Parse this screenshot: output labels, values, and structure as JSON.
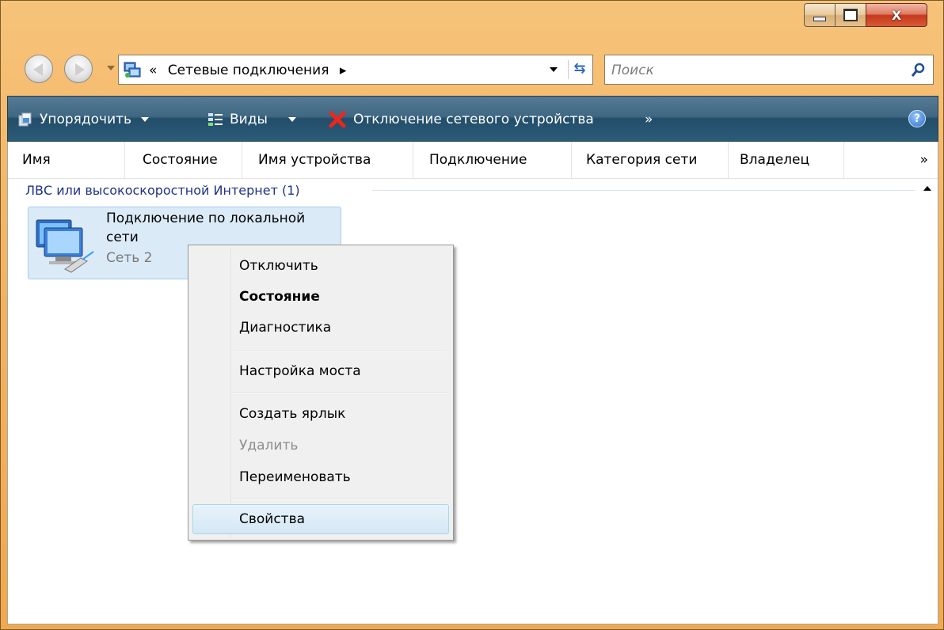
{
  "window": {
    "minimize_icon": "minimize-icon",
    "maximize_icon": "maximize-icon",
    "close_glyph": "X"
  },
  "address_bar": {
    "prefix": "«",
    "location": "Сетевые подключения",
    "separator": "▸",
    "search_placeholder": "Поиск"
  },
  "command_bar": {
    "organize": "Упорядочить",
    "views": "Виды",
    "disconnect": "Отключение сетевого устройства",
    "more": "»",
    "help": "?"
  },
  "columns": [
    "Имя",
    "Состояние",
    "Имя устройства",
    "Подключение",
    "Категория сети",
    "Владелец"
  ],
  "columns_more": "»",
  "group": {
    "title": "ЛВС или высокоскоростной Интернет (1)"
  },
  "item": {
    "name": "Подключение по локальной сети",
    "network": "Сеть 2"
  },
  "context_menu": {
    "items": [
      "Отключить",
      "Состояние",
      "Диагностика",
      "Настройка моста",
      "Создать ярлык",
      "Удалить",
      "Переименовать",
      "Свойства"
    ]
  },
  "colors": {
    "accent": "#234d6a",
    "group_text": "#1e3287",
    "selection": "#dbeaf7"
  }
}
